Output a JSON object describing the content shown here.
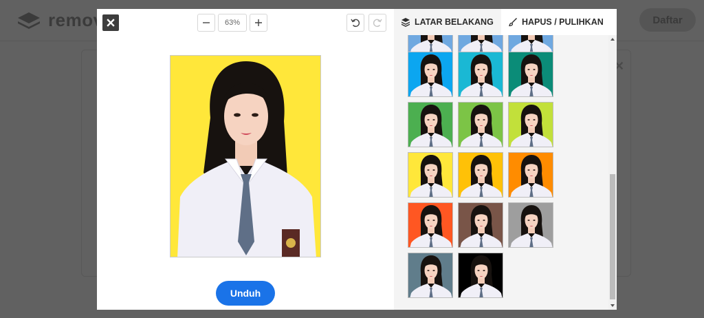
{
  "background_page": {
    "logo_text": "remov",
    "signup_label": "Daftar"
  },
  "editor": {
    "zoom": {
      "value": "63%"
    },
    "download_label": "Unduh",
    "preview_background": "#ffe73a"
  },
  "panel": {
    "tabs": [
      {
        "label": "LATAR BELAKANG",
        "icon": "layers-icon",
        "active": true
      },
      {
        "label": "HAPUS / PULIHKAN",
        "icon": "brush-icon",
        "active": false
      }
    ],
    "colors": {
      "partial_row": [
        "#6fa8e0",
        "#6fa8e0",
        "#6fa8e0"
      ],
      "rows": [
        [
          "#0ca6f0",
          "#1ab8d4",
          "#0b8c78"
        ],
        [
          "#4caf50",
          "#7cc446",
          "#c2e03a"
        ],
        [
          "#ffe73a",
          "#ffc107",
          "#ff8c00"
        ],
        [
          "#ff5722",
          "#795548",
          "#9e9e9e"
        ],
        [
          "#607d8b",
          "#000000"
        ]
      ]
    }
  }
}
